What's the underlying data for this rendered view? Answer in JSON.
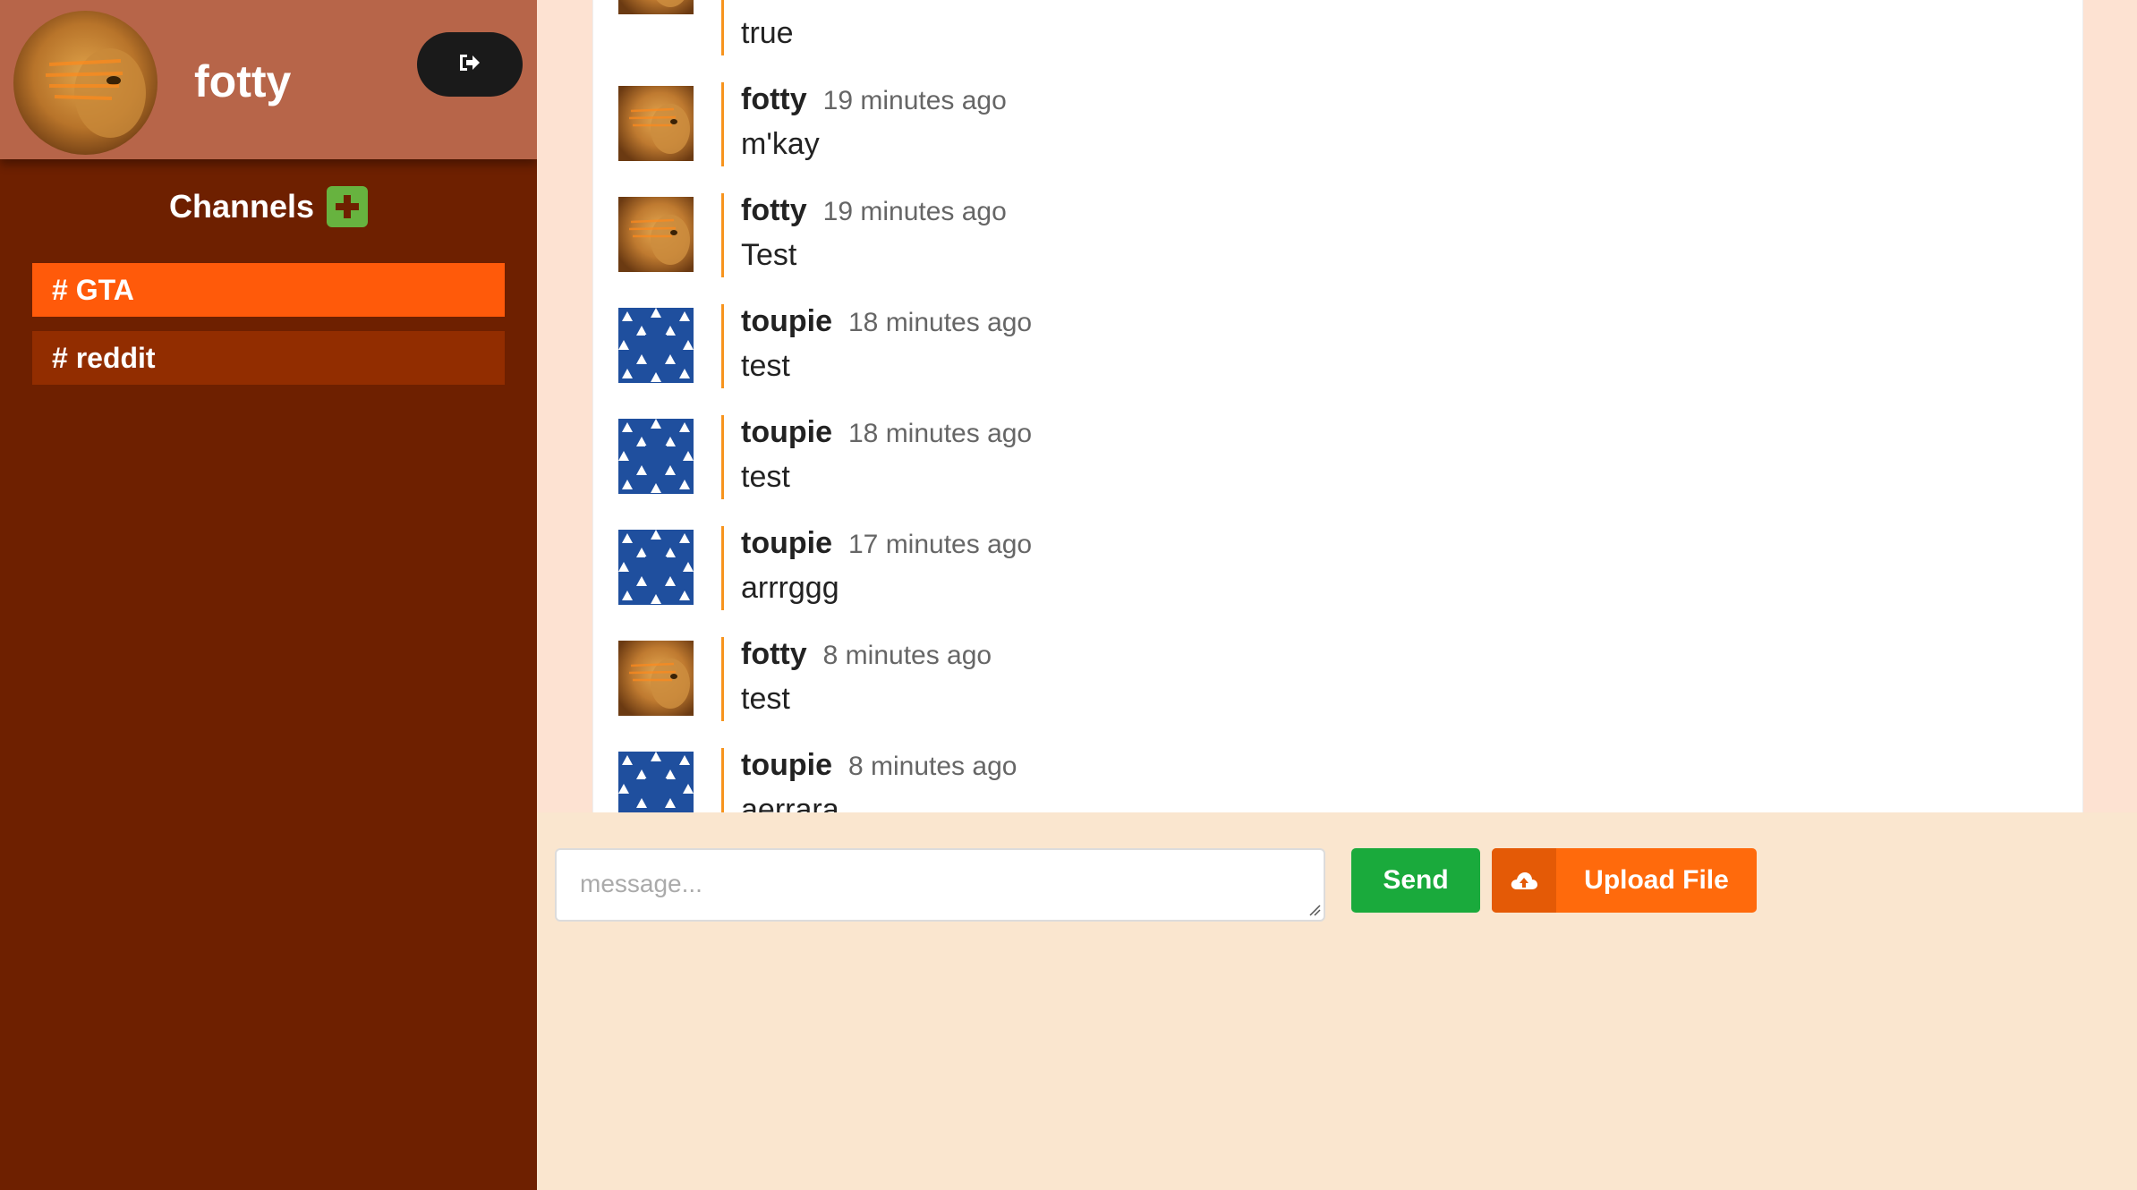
{
  "user": {
    "name": "fotty"
  },
  "sidebar": {
    "channels_title": "Channels",
    "channels": [
      {
        "label": "# GTA",
        "active": true
      },
      {
        "label": "# reddit",
        "active": false
      }
    ]
  },
  "messages": [
    {
      "author": "",
      "time": "",
      "text": "true",
      "avatar": "lion-avatar"
    },
    {
      "author": "fotty",
      "time": "19 minutes ago",
      "text": "m'kay",
      "avatar": "lion-avatar"
    },
    {
      "author": "fotty",
      "time": "19 minutes ago",
      "text": "Test",
      "avatar": "lion-avatar"
    },
    {
      "author": "toupie",
      "time": "18 minutes ago",
      "text": "test",
      "avatar": "pattern-avatar"
    },
    {
      "author": "toupie",
      "time": "18 minutes ago",
      "text": "test",
      "avatar": "pattern-avatar"
    },
    {
      "author": "toupie",
      "time": "17 minutes ago",
      "text": "arrrggg",
      "avatar": "pattern-avatar"
    },
    {
      "author": "fotty",
      "time": "8 minutes ago",
      "text": "test",
      "avatar": "lion-avatar"
    },
    {
      "author": "toupie",
      "time": "8 minutes ago",
      "text": "aerrara",
      "avatar": "pattern-avatar"
    }
  ],
  "composer": {
    "placeholder": "message...",
    "send_label": "Send",
    "upload_label": "Upload File"
  },
  "colors": {
    "sidebar_bg": "#6e2000",
    "profile_bg": "#b76549",
    "active_channel": "#ff5a0a",
    "inactive_channel": "#922d00",
    "send_button": "#1aaa3c",
    "upload_button": "#ff6a0c",
    "message_divider": "#f7941d"
  }
}
